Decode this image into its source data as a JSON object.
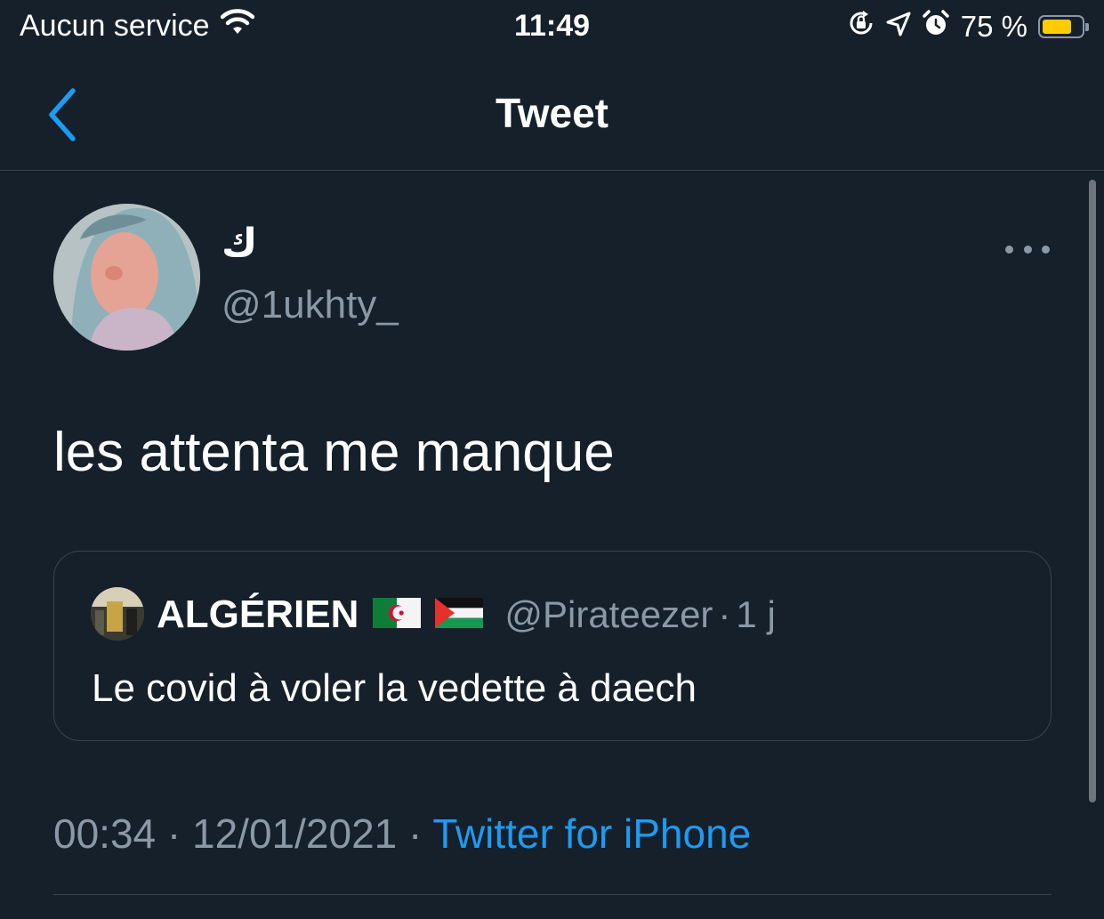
{
  "status_bar": {
    "carrier": "Aucun service",
    "time": "11:49",
    "battery_percent": "75 %",
    "battery_level": 0.75,
    "icons": [
      "wifi-icon",
      "rotation-lock-icon",
      "location-icon",
      "alarm-icon",
      "battery-icon"
    ]
  },
  "nav": {
    "title": "Tweet",
    "back_icon": "chevron-left-icon"
  },
  "tweet": {
    "display_name": "ك",
    "handle": "@1ukhty_",
    "text": "les attenta me manque",
    "more_icon": "more-horizontal-icon"
  },
  "quote": {
    "display_name": "ALGÉRIEN",
    "flags": [
      "algeria-flag-icon",
      "palestine-flag-icon"
    ],
    "handle": "@Pirateezer",
    "separator": "·",
    "time": "1 j",
    "text": "Le covid à voler la vedette à daech"
  },
  "meta": {
    "time": "00:34",
    "separator": "·",
    "date": "12/01/2021",
    "source": "Twitter for iPhone"
  },
  "colors": {
    "background": "#15202b",
    "accent": "#1d9bf0",
    "secondary_text": "#8b98a5",
    "border": "#38444d"
  }
}
